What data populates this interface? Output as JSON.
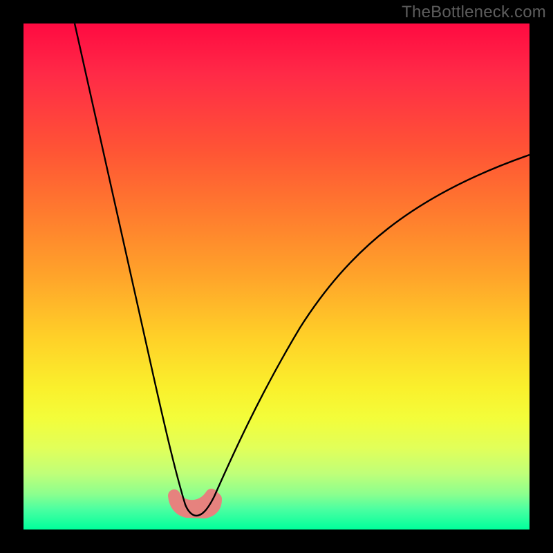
{
  "watermark": {
    "text": "TheBottleneck.com"
  },
  "colors": {
    "background": "#000000",
    "curve": "#000000",
    "blob": "#e6827e",
    "gradient_top": "#ff0a41",
    "gradient_bottom": "#00ff9c"
  },
  "chart_data": {
    "type": "line",
    "title": "",
    "xlabel": "",
    "ylabel": "",
    "xlim": [
      0,
      100
    ],
    "ylim": [
      0,
      100
    ],
    "grid": false,
    "legend": false,
    "note": "Axes implied (no ticks shown). y=0 at bottom (green), y=100 at top (red). x=0 at left edge of colored area.",
    "series": [
      {
        "name": "left-branch",
        "x": [
          10,
          14,
          18,
          22,
          25,
          27,
          29,
          30.5,
          31.5,
          32.5
        ],
        "y": [
          100,
          80,
          60,
          40,
          25,
          16,
          10,
          6,
          4,
          3
        ]
      },
      {
        "name": "right-branch",
        "x": [
          37,
          39,
          42,
          46,
          52,
          60,
          70,
          82,
          95,
          100
        ],
        "y": [
          3,
          6,
          12,
          22,
          35,
          48,
          58,
          66,
          72,
          74
        ]
      }
    ],
    "valley": {
      "name": "valley-marker",
      "x_range": [
        30,
        38
      ],
      "y_range": [
        2,
        6
      ]
    }
  }
}
